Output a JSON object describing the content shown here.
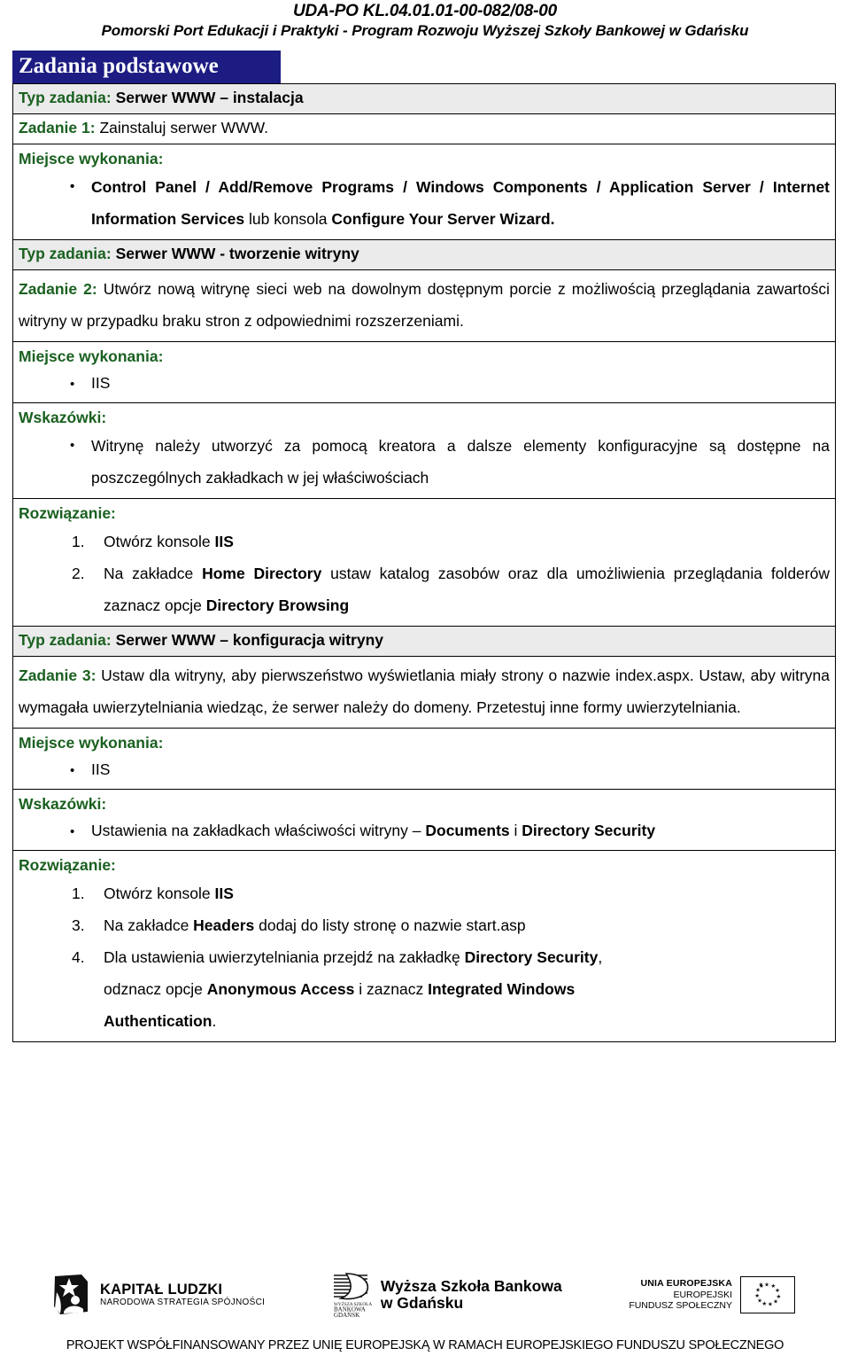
{
  "header": {
    "project_code": "UDA-PO KL.04.01.01-00-082/08-00",
    "project_name": "Pomorski Port Edukacji i Praktyki - Program Rozwoju Wyższej Szkoły Bankowej w Gdańsku"
  },
  "title_bar": {
    "label": "Zadania podstawowe"
  },
  "labels": {
    "typ_zadania": "Typ zadania:",
    "zadanie_1": "Zadanie 1:",
    "zadanie_2": "Zadanie 2:",
    "zadanie_3": "Zadanie 3:",
    "miejsce_wykonania": "Miejsce wykonania:",
    "wskazowki": "Wskazówki:",
    "rozwiazanie": "Rozwiązanie:"
  },
  "tasks": [
    {
      "type_value": "Serwer WWW – instalacja",
      "task_label": "Zadanie 1:",
      "task_text": "Zainstaluj serwer WWW.",
      "place_label": "Miejsce wykonania:",
      "place_items": [
        "Control Panel / Add/Remove Programs / Windows Components / Application Server / Internet Information Services lub konsola Configure Your Server Wizard."
      ]
    },
    {
      "type_value": "Serwer WWW - tworzenie witryny",
      "task_label": "Zadanie 2:",
      "task_text": "Utwórz nową witrynę sieci web na dowolnym dostępnym porcie z możliwością przeglądania zawartości witryny w przypadku braku stron z odpowiednimi rozszerzeniami.",
      "place_label": "Miejsce wykonania:",
      "place_items": [
        "IIS"
      ],
      "hints_label": "Wskazówki:",
      "hints": [
        "Witrynę należy utworzyć za pomocą kreatora a dalsze elementy konfiguracyjne są dostępne na poszczególnych zakładkach w jej właściwościach"
      ],
      "solution_label": "Rozwiązanie:",
      "steps": [
        {
          "num": "1.",
          "text": "Otwórz konsole IIS"
        },
        {
          "num": "2.",
          "text": "Na zakładce Home Directory ustaw katalog zasobów oraz dla umożliwienia przeglądania folderów zaznacz opcje Directory Browsing"
        }
      ]
    },
    {
      "type_value": "Serwer WWW – konfiguracja witryny",
      "task_label": "Zadanie 3:",
      "task_text": "Ustaw dla witryny, aby pierwszeństwo wyświetlania miały strony o nazwie index.aspx. Ustaw, aby witryna wymagała uwierzytelniania wiedząc, że serwer należy do domeny. Przetestuj inne formy uwierzytelniania.",
      "place_label": "Miejsce wykonania:",
      "place_items": [
        "IIS"
      ],
      "hints_label": "Wskazówki:",
      "hints": [
        "Ustawienia na zakładkach właściwości witryny – Documents i Directory Security"
      ],
      "solution_label": "Rozwiązanie:",
      "steps": [
        {
          "num": "1.",
          "text": "Otwórz konsole IIS"
        },
        {
          "num": "3.",
          "text": "Na zakładce Headers dodaj do listy stronę o nazwie start.asp"
        },
        {
          "num": "4.",
          "text": "Dla ustawienia uwierzytelniania przejdź na zakładkę Directory Security, odznacz opcje Anonymous Access i zaznacz Integrated Windows Authentication."
        }
      ]
    }
  ],
  "footer": {
    "kapital_ludzki": {
      "line1": "KAPITAŁ LUDZKI",
      "line2": "NARODOWA STRATEGIA SPÓJNOŚCI"
    },
    "wsb": {
      "line1": "Wyższa Szkoła Bankowa",
      "line2": "w Gdańsku"
    },
    "unia": {
      "line1": "UNIA EUROPEJSKA",
      "line2": "EUROPEJSKI",
      "line3": "FUNDUSZ SPOŁECZNY"
    },
    "note": "PROJEKT WSPÓŁFINANSOWANY PRZEZ UNIĘ EUROPEJSKĄ W RAMACH EUROPEJSKIEGO FUNDUSZU SPOŁECZNEGO"
  },
  "colors": {
    "title_bar_bg": "#1c1c82",
    "label_green": "#1a6020",
    "type_row_bg": "#ebebeb"
  }
}
